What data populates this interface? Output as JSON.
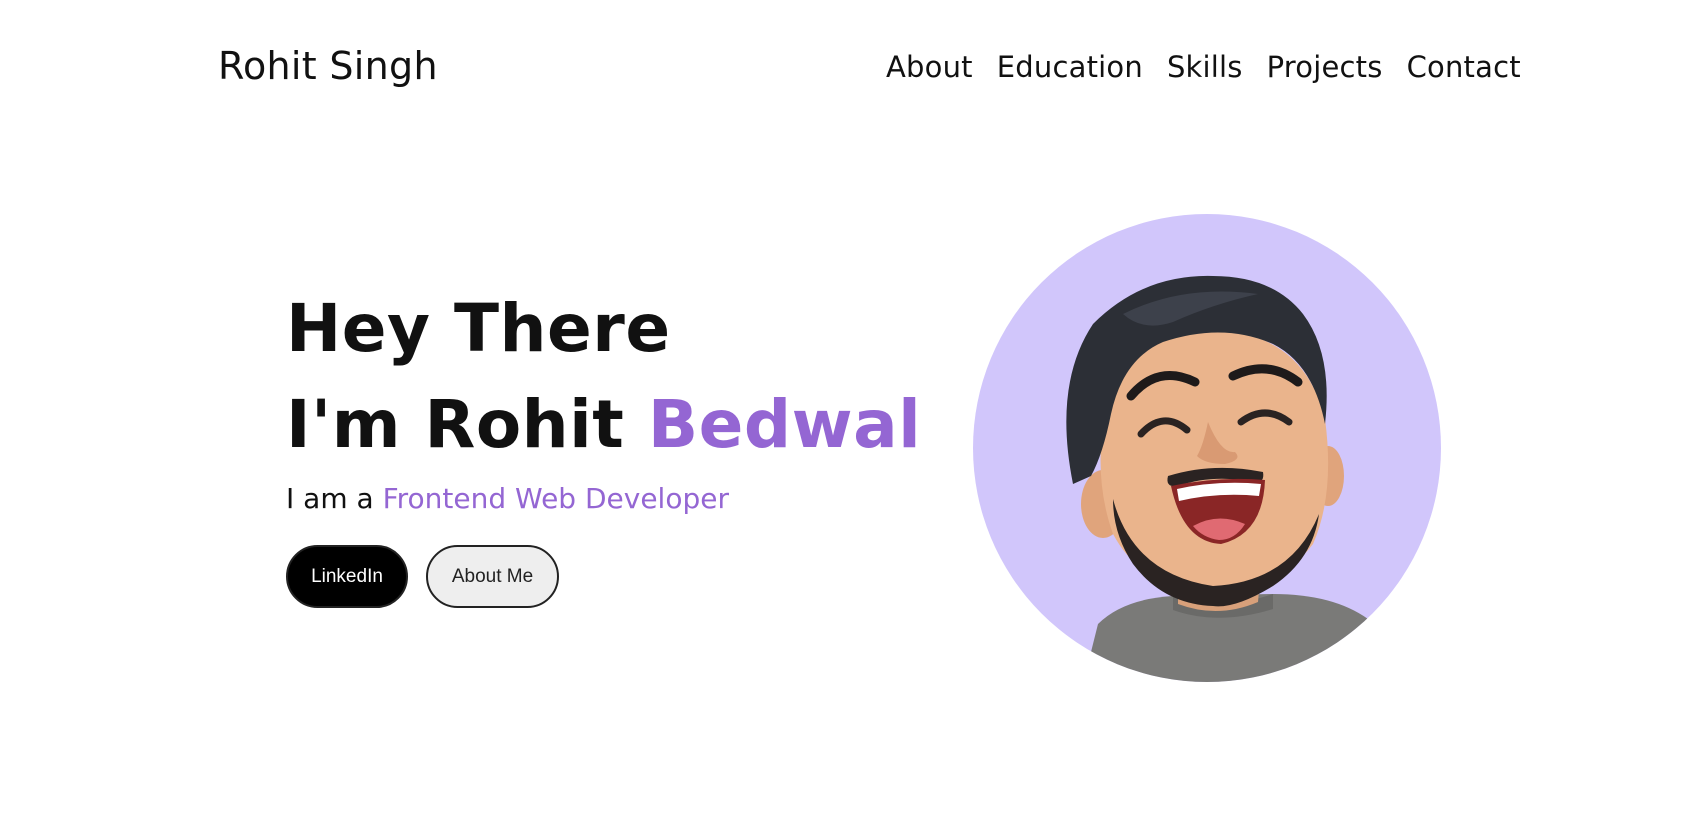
{
  "header": {
    "brand": "Rohit Singh",
    "nav": [
      "About",
      "Education",
      "Skills",
      "Projects",
      "Contact"
    ]
  },
  "hero": {
    "line1": "Hey There",
    "line2_prefix": "I'm Rohit ",
    "line2_accent": "Bedwal",
    "sub_prefix": "I am a ",
    "sub_accent": "Frontend Web Developer",
    "buttons": {
      "linkedin": "LinkedIn",
      "about": "About Me"
    }
  },
  "avatar": {
    "icon": "laughing-avatar-illustration"
  },
  "colors": {
    "accent": "#9466d3",
    "avatar_bg": "#d1c6fb",
    "button_dark": "#000000",
    "button_light": "#eeeeee"
  }
}
